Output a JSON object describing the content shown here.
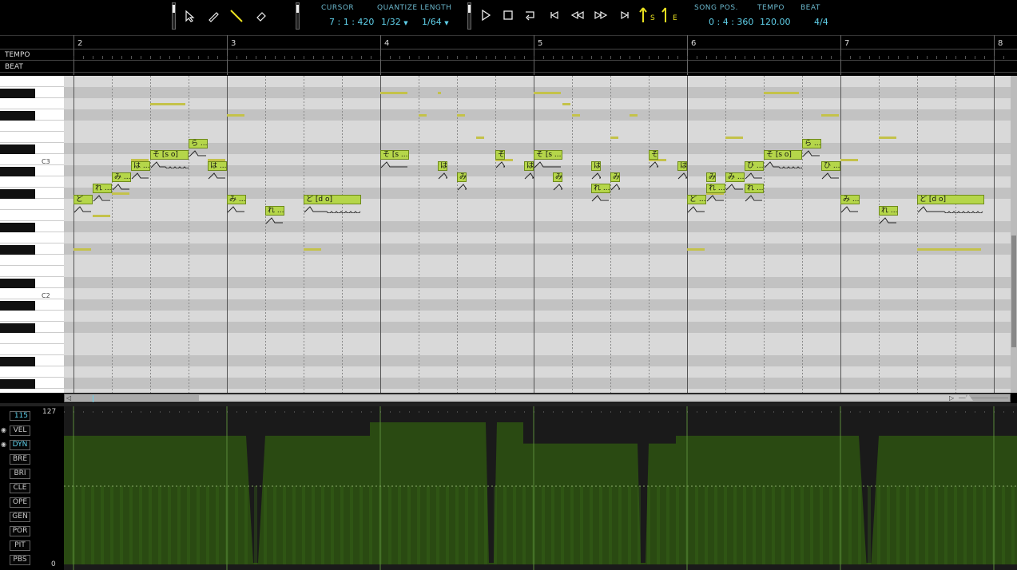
{
  "toolbar": {
    "labels": {
      "cursor": "CURSOR",
      "quantize": "QUANTIZE",
      "length": "LENGTH",
      "song_pos": "SONG POS.",
      "tempo": "TEMPO",
      "beat": "BEAT"
    },
    "values": {
      "cursor": "7 : 1 : 420",
      "quantize": "1/32",
      "length": "1/64",
      "song_pos": "0 : 4 : 360",
      "tempo": "120.00",
      "beat": "4/4"
    },
    "tools": [
      "arrow-icon",
      "pencil-icon",
      "line-icon",
      "eraser-icon"
    ],
    "transport": [
      "play-icon",
      "stop-icon",
      "loop-icon",
      "go-start-icon",
      "rewind-icon",
      "fast-forward-icon",
      "go-end-icon"
    ],
    "markers": {
      "start": "S",
      "end": "E"
    }
  },
  "ruler": {
    "measures": [
      "2",
      "3",
      "4",
      "5",
      "6",
      "7",
      "8"
    ],
    "tempo_label": "TEMPO",
    "beat_label": "BEAT"
  },
  "piano": {
    "octave_labels": [
      "C3",
      "C2"
    ]
  },
  "notes": [
    {
      "lyric": "ど",
      "bar": 2,
      "beat": 0,
      "len": 0.5,
      "row": 10
    },
    {
      "lyric": "れ ...",
      "bar": 2,
      "beat": 0.5,
      "len": 0.5,
      "row": 9
    },
    {
      "lyric": "み ...",
      "bar": 2,
      "beat": 1,
      "len": 0.5,
      "row": 8
    },
    {
      "lyric": "は ...",
      "bar": 2,
      "beat": 1.5,
      "len": 0.5,
      "row": 7
    },
    {
      "lyric": "そ [s o]",
      "bar": 2,
      "beat": 2,
      "len": 1,
      "row": 6
    },
    {
      "lyric": "ら ...",
      "bar": 2,
      "beat": 3,
      "len": 0.5,
      "row": 5
    },
    {
      "lyric": "は ...",
      "bar": 2,
      "beat": 3.5,
      "len": 0.5,
      "row": 7
    },
    {
      "lyric": "み ...",
      "bar": 3,
      "beat": 0,
      "len": 0.5,
      "row": 10
    },
    {
      "lyric": "れ ...",
      "bar": 3,
      "beat": 1,
      "len": 0.5,
      "row": 11
    },
    {
      "lyric": "ど [d o]",
      "bar": 3,
      "beat": 2,
      "len": 1.5,
      "row": 10
    },
    {
      "lyric": "そ [s ...",
      "bar": 4,
      "beat": 0,
      "len": 0.75,
      "row": 6
    },
    {
      "lyric": "は",
      "bar": 4,
      "beat": 1.5,
      "len": 0.25,
      "row": 7
    },
    {
      "lyric": "み",
      "bar": 4,
      "beat": 2,
      "len": 0.25,
      "row": 8
    },
    {
      "lyric": "そ",
      "bar": 4,
      "beat": 3,
      "len": 0.25,
      "row": 6
    },
    {
      "lyric": "は",
      "bar": 4,
      "beat": 3.75,
      "len": 0.25,
      "row": 7
    },
    {
      "lyric": "み",
      "bar": 4,
      "beat": 4.5,
      "len": 0.25,
      "row": 8
    },
    {
      "lyric": "れ ...",
      "bar": 4,
      "beat": 5.5,
      "len": 0.5,
      "row": 9
    },
    {
      "lyric": "そ [s ...",
      "bar": 5,
      "beat": 0,
      "len": 0.75,
      "row": 6
    },
    {
      "lyric": "は",
      "bar": 5,
      "beat": 1.5,
      "len": 0.25,
      "row": 7
    },
    {
      "lyric": "み",
      "bar": 5,
      "beat": 2,
      "len": 0.25,
      "row": 8
    },
    {
      "lyric": "そ",
      "bar": 5,
      "beat": 3,
      "len": 0.25,
      "row": 6
    },
    {
      "lyric": "は",
      "bar": 5,
      "beat": 3.75,
      "len": 0.25,
      "row": 7
    },
    {
      "lyric": "み",
      "bar": 5,
      "beat": 4.5,
      "len": 0.25,
      "row": 8
    },
    {
      "lyric": "れ ...",
      "bar": 5,
      "beat": 5.5,
      "len": 0.5,
      "row": 9
    },
    {
      "lyric": "ど ...",
      "bar": 6,
      "beat": 0,
      "len": 0.5,
      "row": 10
    },
    {
      "lyric": "れ ...",
      "bar": 6,
      "beat": 0.5,
      "len": 0.5,
      "row": 9
    },
    {
      "lyric": "み ...",
      "bar": 6,
      "beat": 1,
      "len": 0.5,
      "row": 8
    },
    {
      "lyric": "ひ ...",
      "bar": 6,
      "beat": 1.5,
      "len": 0.5,
      "row": 7
    },
    {
      "lyric": "そ [s o]",
      "bar": 6,
      "beat": 2,
      "len": 1,
      "row": 6
    },
    {
      "lyric": "ら ...",
      "bar": 6,
      "beat": 3,
      "len": 0.5,
      "row": 5
    },
    {
      "lyric": "ひ ...",
      "bar": 6,
      "beat": 3.5,
      "len": 0.5,
      "row": 7
    },
    {
      "lyric": "み ...",
      "bar": 7,
      "beat": 0,
      "len": 0.5,
      "row": 10
    },
    {
      "lyric": "れ ...",
      "bar": 7,
      "beat": 1,
      "len": 0.5,
      "row": 11
    },
    {
      "lyric": "ど [d o]",
      "bar": 7,
      "beat": 2,
      "len": 1.75,
      "row": 10
    }
  ],
  "controller": {
    "value": "115",
    "max_label": "127",
    "min_label": "0",
    "buttons": [
      "VEL",
      "DYN",
      "BRE",
      "BRI",
      "CLE",
      "OPE",
      "GEN",
      "POR",
      "PIT",
      "PBS"
    ],
    "selected": "DYN",
    "eye_buttons": [
      "VEL",
      "DYN"
    ],
    "dyn_levels": [
      115,
      115,
      0,
      115,
      115,
      127,
      0,
      127,
      108,
      108,
      0,
      108,
      115,
      115,
      0,
      115
    ],
    "colors": {
      "fill": "#2a4a12",
      "top": "#1a1a1a",
      "grid": "#3a6a1a"
    }
  },
  "colors": {
    "accent": "#5fd0ea",
    "note": "#b5d64a",
    "marker": "#e8e020"
  }
}
